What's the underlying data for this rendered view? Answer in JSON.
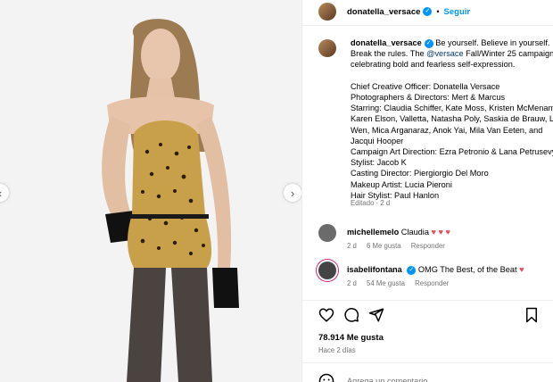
{
  "post_author": {
    "username": "donatella_versace",
    "follow_label": "Seguir"
  },
  "caption": {
    "username": "donatella_versace",
    "text_before_mention": "Be yourself. Believe in yourself. Break the rules. The ",
    "mention": "@versace",
    "text_after_mention": " Fall/Winter 25 campaign, celebrating bold and fearless self-expression.",
    "credits": "Chief Creative Officer: Donatella Versace\nPhotographers & Directors: Mert & Marcus\nStarring: Claudia Schiffer, Kate Moss, Kristen McMenamy, Karen Elson, Valletta, Natasha Poly, Saskia de Brauw, Liu Wen, Mica Arganaraz, Anok Yai, Mila Van Eeten, and Jacqui Hooper\nCampaign Art Direction: Ezra Petronio & Lana Petrusevych\nStylist: Jacob K\nCasting Director: Piergiorgio Del Moro\nMakeup Artist: Lucia Pieroni\nHair Stylist: Paul Hanlon",
    "edited_label": "Editado · 2 d"
  },
  "comments": [
    {
      "username": "michellemelo",
      "text": "Claudia",
      "hearts": "♥ ♥ ♥",
      "time": "2 d",
      "likes": "6 Me gusta",
      "reply": "Responder",
      "avatar_color": "#6b6b6b"
    },
    {
      "username": "isabelifontana",
      "text": "OMG The Best, of the Beat",
      "hearts": "♥",
      "time": "2 d",
      "likes": "54 Me gusta",
      "reply": "Responder",
      "avatar_color": "#444444"
    }
  ],
  "likes_count": "78.914 Me gusta",
  "posted_ago": "Hace 2 días",
  "add_comment_placeholder": "Agrega un comentario...",
  "colors": {
    "link": "#0095f6",
    "mention": "#00376b",
    "heart": "#ed4956",
    "muted": "#737373"
  },
  "icons": [
    "like-heart-icon",
    "comment-bubble-icon",
    "share-icon",
    "save-bookmark-icon",
    "emoji-icon",
    "prev-arrow-icon",
    "next-arrow-icon",
    "verified-badge-icon"
  ]
}
